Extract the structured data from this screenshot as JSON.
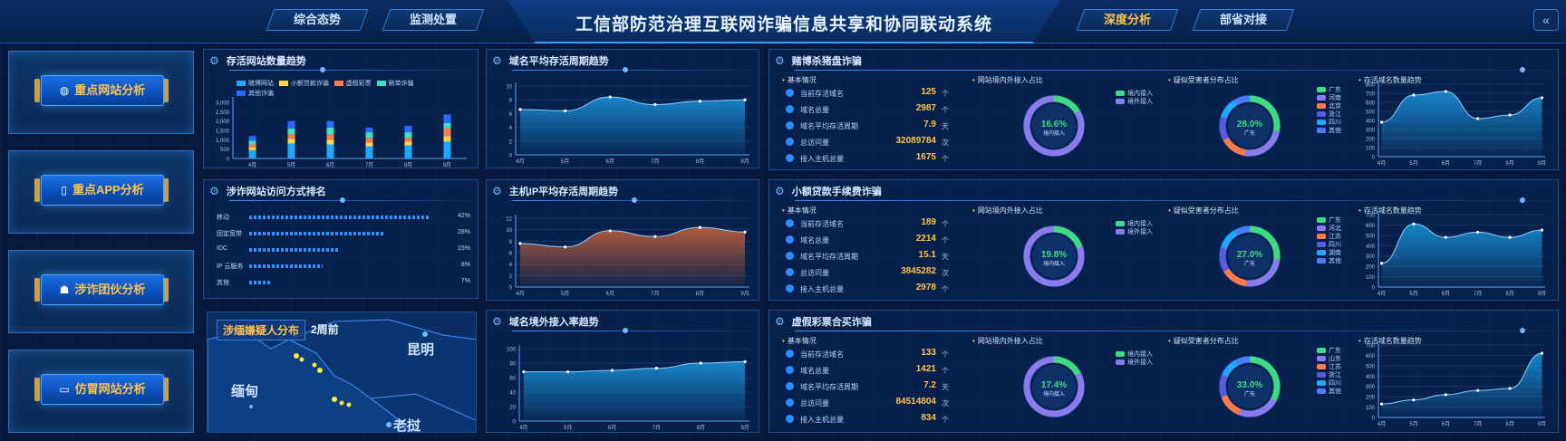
{
  "header": {
    "title": "工信部防范治理互联网诈骗信息共享和协同联动系统",
    "nav": [
      "综合态势",
      "监测处置",
      "深度分析",
      "部省对接"
    ],
    "active_nav": "深度分析",
    "collapse_icon": "double-chevron-left-icon"
  },
  "sidebar": {
    "items": [
      {
        "label": "重点网站分析",
        "icon": "globe-icon"
      },
      {
        "label": "重点APP分析",
        "icon": "phone-icon"
      },
      {
        "label": "涉诈团伙分析",
        "icon": "group-icon"
      },
      {
        "label": "仿冒网站分析",
        "icon": "monitor-icon"
      }
    ]
  },
  "panels": {
    "site_count": {
      "title": "存活网站数量趋势",
      "legend": [
        "赌博网站",
        "小额贷款诈骗",
        "虚假彩票",
        "刷单诈骗",
        "其他诈骗"
      ],
      "chart_data": {
        "type": "bar",
        "categories": [
          "4月",
          "5月",
          "6月",
          "7月",
          "8月",
          "9月"
        ],
        "ylim": [
          0,
          3000
        ],
        "yticks": [
          "3,000",
          "2,500",
          "2,000",
          "1,500",
          "1,000",
          "500",
          "0"
        ],
        "series": [
          {
            "name": "赌博网站",
            "values": [
              450,
              800,
              750,
              650,
              700,
              900
            ],
            "color": "#1fa8ff"
          },
          {
            "name": "小额贷款诈骗",
            "values": [
              150,
              250,
              250,
              200,
              200,
              300
            ],
            "color": "#ffd84a"
          },
          {
            "name": "虚假彩票",
            "values": [
              150,
              250,
              300,
              250,
              200,
              400
            ],
            "color": "#ff7a4a"
          },
          {
            "name": "刷单诈骗",
            "values": [
              200,
              300,
              350,
              300,
              300,
              300
            ],
            "color": "#3de0c0"
          },
          {
            "name": "其他诈骗",
            "values": [
              250,
              400,
              350,
              250,
              350,
              450
            ],
            "color": "#2a6bff"
          }
        ]
      }
    },
    "access_rank": {
      "title": "涉诈网站访问方式排名",
      "rows": [
        {
          "name": "移动",
          "value": "42%",
          "fill": 0.94
        },
        {
          "name": "固定宽带",
          "value": "28%",
          "fill": 0.7
        },
        {
          "name": "IDC",
          "value": "15%",
          "fill": 0.46
        },
        {
          "name": "IP 云服务",
          "value": "8%",
          "fill": 0.38
        },
        {
          "name": "其他",
          "value": "7%",
          "fill": 0.12
        }
      ]
    },
    "domain_life": {
      "title": "域名平均存活周期趋势",
      "chart_data": {
        "type": "area",
        "x": [
          "4月",
          "5月",
          "6月",
          "7月",
          "8月",
          "9月"
        ],
        "values": [
          6.6,
          6.4,
          8.4,
          7.3,
          7.8,
          8.0
        ],
        "ylim": [
          0,
          10
        ],
        "yticks": [
          "10",
          "8",
          "6",
          "4",
          "2",
          "0"
        ],
        "color": "#1a8fd6"
      }
    },
    "ip_life": {
      "title": "主机IP平均存活周期趋势",
      "chart_data": {
        "type": "area",
        "x": [
          "4月",
          "5月",
          "6月",
          "7月",
          "8月",
          "9月"
        ],
        "values": [
          7.6,
          7.0,
          9.8,
          8.8,
          10.4,
          9.6
        ],
        "ylim": [
          0,
          12
        ],
        "yticks": [
          "12",
          "10",
          "8",
          "6",
          "4",
          "2",
          "0"
        ],
        "color": "#c0603a"
      }
    },
    "foreign_rate": {
      "title": "域名境外接入率趋势",
      "chart_data": {
        "type": "area",
        "x": [
          "4月",
          "5月",
          "6月",
          "7月",
          "8月",
          "9月"
        ],
        "values": [
          68,
          68,
          70,
          73,
          80,
          82
        ],
        "ylim": [
          0,
          100
        ],
        "yticks": [
          "100",
          "80",
          "60",
          "40",
          "20",
          "0"
        ],
        "color": "#1a8fd6"
      }
    }
  },
  "map": {
    "title": "涉缅嫌疑人分布",
    "period": "2周前",
    "labels": [
      "昆明",
      "缅甸",
      "老挝"
    ]
  },
  "fraud_blocks": [
    {
      "title": "赌博杀猪盘诈骗",
      "basic_label": "基本情况",
      "stats": [
        {
          "name": "当前存活域名",
          "value": "125",
          "unit": "个"
        },
        {
          "name": "域名总量",
          "value": "2987",
          "unit": "个"
        },
        {
          "name": "域名平均存活周期",
          "value": "7.9",
          "unit": "天"
        },
        {
          "name": "总访问量",
          "value": "32089784",
          "unit": "次"
        },
        {
          "name": "接入主机总量",
          "value": "1675",
          "unit": "个"
        }
      ],
      "ratio_title": "网站境内外接入占比",
      "ratio": {
        "pct": "16.6%",
        "label": "境内接入",
        "value": 0.166,
        "legend": [
          "境内接入",
          "境外接入"
        ]
      },
      "victim_title": "疑似受害者分布占比",
      "victim": {
        "pct": "28.0%",
        "label": "广东",
        "value": 0.28,
        "legend": [
          "广东",
          "河南",
          "北京",
          "浙江",
          "四川",
          "其他"
        ]
      },
      "trend_title": "存活域名数量趋势",
      "trend": {
        "type": "area",
        "x": [
          "4月",
          "5月",
          "6月",
          "7月",
          "8月",
          "9月"
        ],
        "values": [
          380,
          680,
          720,
          420,
          460,
          650
        ],
        "ylim": [
          0,
          800
        ],
        "yticks": [
          "800",
          "700",
          "600",
          "500",
          "400",
          "300",
          "200",
          "100",
          "0"
        ]
      }
    },
    {
      "title": "小额贷款手续费诈骗",
      "basic_label": "基本情况",
      "stats": [
        {
          "name": "当前存活域名",
          "value": "189",
          "unit": "个"
        },
        {
          "name": "域名总量",
          "value": "2214",
          "unit": "个"
        },
        {
          "name": "域名平均存活周期",
          "value": "15.1",
          "unit": "天"
        },
        {
          "name": "总访问量",
          "value": "3845282",
          "unit": "次"
        },
        {
          "name": "接入主机总量",
          "value": "2978",
          "unit": "个"
        }
      ],
      "ratio_title": "网站境内外接入占比",
      "ratio": {
        "pct": "19.8%",
        "label": "境内接入",
        "value": 0.198,
        "legend": [
          "境内接入",
          "境外接入"
        ]
      },
      "victim_title": "疑似受害者分布占比",
      "victim": {
        "pct": "27.0%",
        "label": "广东",
        "value": 0.27,
        "legend": [
          "广东",
          "河北",
          "江苏",
          "四川",
          "湖南",
          "其他"
        ]
      },
      "trend_title": "存活域名数量趋势",
      "trend": {
        "type": "area",
        "x": [
          "4月",
          "5月",
          "6月",
          "7月",
          "8月",
          "9月"
        ],
        "values": [
          230,
          610,
          480,
          530,
          480,
          550
        ],
        "ylim": [
          0,
          700
        ],
        "yticks": [
          "700",
          "600",
          "500",
          "400",
          "300",
          "200",
          "100",
          "0"
        ]
      }
    },
    {
      "title": "虚假彩票合买诈骗",
      "basic_label": "基本情况",
      "stats": [
        {
          "name": "当前存活域名",
          "value": "133",
          "unit": "个"
        },
        {
          "name": "域名总量",
          "value": "1421",
          "unit": "个"
        },
        {
          "name": "域名平均存活周期",
          "value": "7.2",
          "unit": "天"
        },
        {
          "name": "总访问量",
          "value": "84514804",
          "unit": "次"
        },
        {
          "name": "接入主机总量",
          "value": "834",
          "unit": "个"
        }
      ],
      "ratio_title": "网站境内外接入占比",
      "ratio": {
        "pct": "17.4%",
        "label": "境内接入",
        "value": 0.174,
        "legend": [
          "境内接入",
          "境外接入"
        ]
      },
      "victim_title": "疑似受害者分布占比",
      "victim": {
        "pct": "33.0%",
        "label": "广东",
        "value": 0.33,
        "legend": [
          "广东",
          "山东",
          "江苏",
          "浙江",
          "四川",
          "其他"
        ]
      },
      "trend_title": "存活域名数量趋势",
      "trend": {
        "type": "area",
        "x": [
          "4月",
          "5月",
          "6月",
          "7月",
          "8月",
          "9月"
        ],
        "values": [
          130,
          170,
          220,
          260,
          280,
          620
        ],
        "ylim": [
          0,
          700
        ],
        "yticks": [
          "700",
          "600",
          "500",
          "400",
          "300",
          "200",
          "100",
          "0"
        ]
      }
    }
  ],
  "colors": {
    "accent": "#ffc24a",
    "ratio_domestic": "#3ddc84",
    "ratio_foreign": "#8a7cf0",
    "victim": [
      "#3ddc84",
      "#8a7cf0",
      "#ff7a4a",
      "#5a5adf",
      "#1fa8ff",
      "#4a7cff"
    ]
  }
}
